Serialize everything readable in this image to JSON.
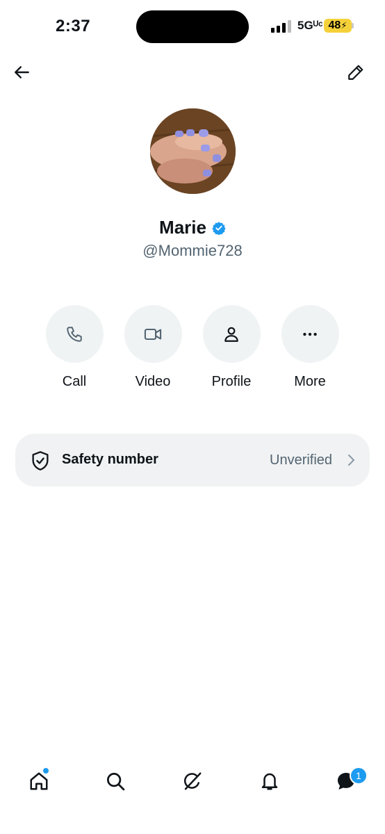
{
  "status_bar": {
    "time": "2:37",
    "network": "5Gᵁᶜ",
    "battery": "48"
  },
  "header": {
    "back_icon": "arrow-left-icon",
    "edit_icon": "pencil-icon"
  },
  "profile": {
    "name": "Marie",
    "handle": "@Mommie728",
    "verified": true,
    "verified_color": "#1d9bf0"
  },
  "actions": [
    {
      "label": "Call",
      "icon": "phone-icon"
    },
    {
      "label": "Video",
      "icon": "video-camera-icon"
    },
    {
      "label": "Profile",
      "icon": "person-icon"
    },
    {
      "label": "More",
      "icon": "more-dots-icon"
    }
  ],
  "safety": {
    "label": "Safety number",
    "status": "Unverified"
  },
  "bottom_nav": {
    "items": [
      "home-icon",
      "search-icon",
      "grok-icon",
      "bell-icon",
      "messages-icon"
    ],
    "messages_badge": "1"
  },
  "colors": {
    "accent": "#1d9bf0",
    "battery": "#f4d13a"
  }
}
